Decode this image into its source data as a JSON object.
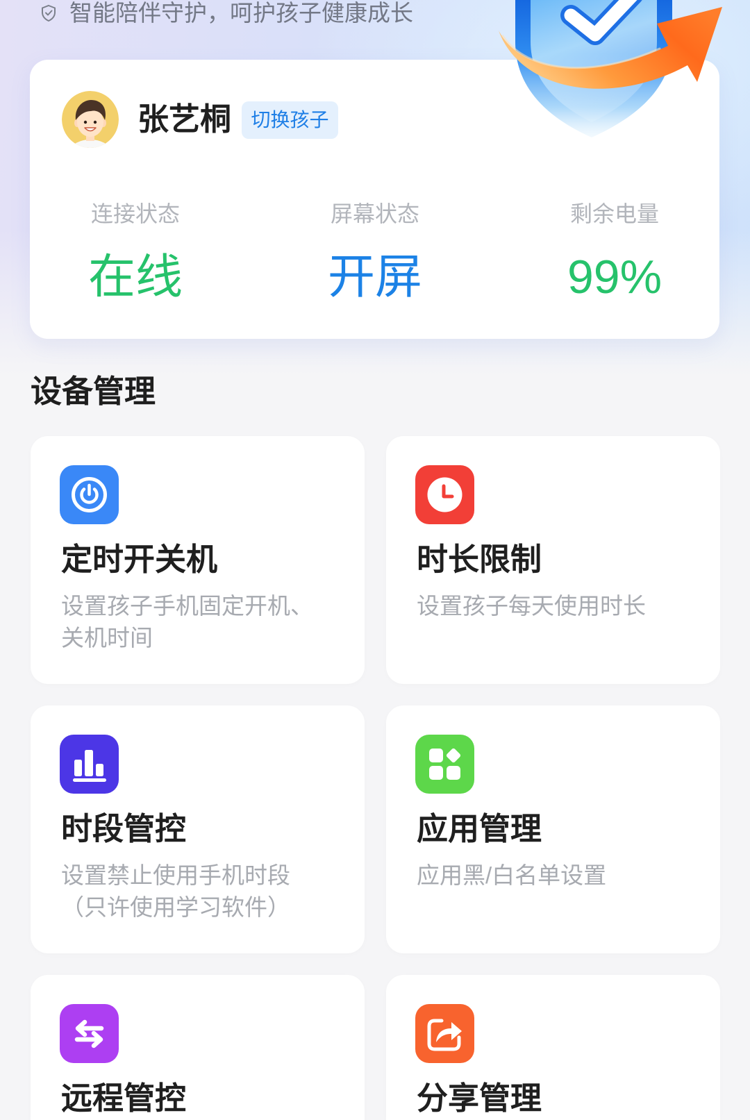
{
  "tagline": "智能陪伴守护，呵护孩子健康成长",
  "tagline_icon": "shield-check-icon",
  "hero_icon": "shield-check-arrow-icon",
  "child": {
    "name": "张艺桐",
    "switch_label": "切换孩子"
  },
  "status": [
    {
      "label": "连接状态",
      "value": "在线",
      "color": "#26c26b"
    },
    {
      "label": "屏幕状态",
      "value": "开屏",
      "color": "#1c82e6"
    },
    {
      "label": "剩余电量",
      "value": "99%",
      "color": "#26c26b"
    }
  ],
  "section_title": "设备管理",
  "features": [
    {
      "title": "定时开关机",
      "desc_lines": [
        "设置孩子手机固定开机、",
        "关机时间"
      ],
      "icon": "power-icon",
      "color": "#3a88f7"
    },
    {
      "title": "时长限制",
      "desc_lines": [
        "设置孩子每天使用时长"
      ],
      "icon": "clock-icon",
      "color": "#f23f37"
    },
    {
      "title": "时段管控",
      "desc_lines": [
        "设置禁止使用手机时段",
        "（只许使用学习软件）"
      ],
      "icon": "bar-chart-icon",
      "color": "#4c36e6"
    },
    {
      "title": "应用管理",
      "desc_lines": [
        "应用黑/白名单设置"
      ],
      "icon": "apps-grid-icon",
      "color": "#5dd74a"
    },
    {
      "title": "远程管控",
      "desc_lines": [],
      "icon": "swap-arrows-icon",
      "color": "#ad3ff2"
    },
    {
      "title": "分享管理",
      "desc_lines": [],
      "icon": "share-icon",
      "color": "#f8632e"
    }
  ],
  "colors": {
    "page_bg": "#f5f5f7",
    "badge_bg": "#e4f0fd",
    "badge_text": "#1f7fe6"
  }
}
